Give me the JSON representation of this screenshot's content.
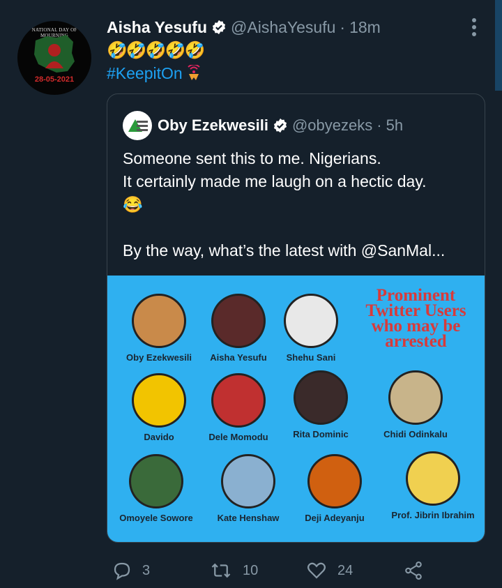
{
  "author": {
    "name": "Aisha Yesufu",
    "handle": "@AishaYesufu",
    "separator": "·",
    "time": "18m",
    "avatar_banner": "NATIONAL DAY OF MOURNING",
    "avatar_date": "28-05-2021"
  },
  "tweet": {
    "emojis": "🤣🤣🤣🤣🤣",
    "hashtag": "#KeepitOn"
  },
  "quoted": {
    "name": "Oby Ezekwesili",
    "handle": "@obyezeks",
    "separator": "·",
    "time": "5h",
    "text_line1": "Someone sent this to me. Nigerians.",
    "text_line2": "It certainly made me laugh on a hectic day.",
    "text_emoji": "😂",
    "text_line3": "By the way, what’s the latest with @SanMal...",
    "image": {
      "headline": "Prominent Twitter Users who may be arrested",
      "people": [
        {
          "name": "Oby Ezekwesili",
          "color": "#c98a4a"
        },
        {
          "name": "Aisha Yesufu",
          "color": "#5a2a2a"
        },
        {
          "name": "Shehu Sani",
          "color": "#e8e8e8"
        },
        {
          "name": "Davido",
          "color": "#f2c400"
        },
        {
          "name": "Dele Momodu",
          "color": "#c03030"
        },
        {
          "name": "Rita Dominic",
          "color": "#3a2a2a"
        },
        {
          "name": "Chidi Odinkalu",
          "color": "#c8b48a"
        },
        {
          "name": "Omoyele Sowore",
          "color": "#3a6a3a"
        },
        {
          "name": "Kate Henshaw",
          "color": "#8ab0d0"
        },
        {
          "name": "Deji Adeyanju",
          "color": "#d06010"
        },
        {
          "name": "Prof. Jibrin Ibrahim",
          "color": "#f0d050"
        }
      ]
    }
  },
  "actions": {
    "replies": "3",
    "retweets": "10",
    "likes": "24"
  },
  "colors": {
    "background": "#15202b",
    "accent": "#1da1f2",
    "muted": "#8899a6",
    "image_bg": "#2fb0f0",
    "headline_red": "#d83a3a"
  },
  "icons": [
    "verified-badge-icon",
    "more-options-icon",
    "reply-icon",
    "retweet-icon",
    "like-icon",
    "share-icon",
    "signal-icon"
  ]
}
